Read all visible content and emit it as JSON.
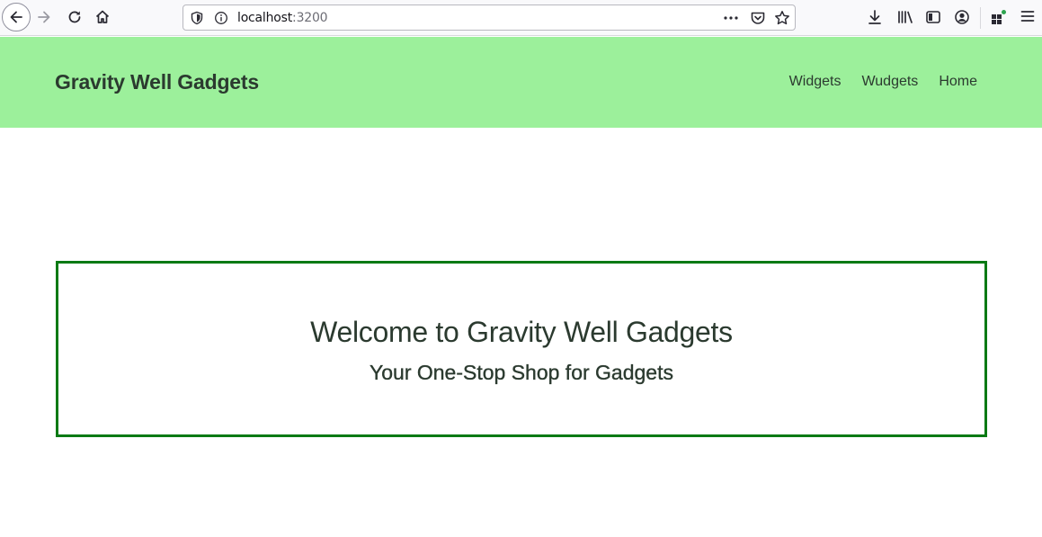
{
  "browser": {
    "url_host": "localhost",
    "url_port": ":3200",
    "icons": {
      "back": "back-arrow-icon",
      "forward": "forward-arrow-icon",
      "reload": "reload-icon",
      "home": "home-icon",
      "tracking": "shield-icon",
      "site_info": "info-icon",
      "page_actions": "more-dots-icon",
      "pocket": "pocket-icon",
      "bookmark": "star-icon",
      "downloads": "download-icon",
      "library": "library-icon",
      "sidebar": "sidebar-icon",
      "account": "account-icon",
      "extensions": "extensions-icon",
      "menu": "hamburger-menu-icon"
    }
  },
  "header": {
    "brand": "Gravity Well Gadgets",
    "nav": [
      {
        "label": "Widgets"
      },
      {
        "label": "Wudgets"
      },
      {
        "label": "Home"
      }
    ],
    "background": "#9cf09b"
  },
  "hero": {
    "title": "Welcome to Gravity Well Gadgets",
    "subtitle": "Your One-Stop Shop for Gadgets",
    "border_color": "#0a7a14"
  }
}
